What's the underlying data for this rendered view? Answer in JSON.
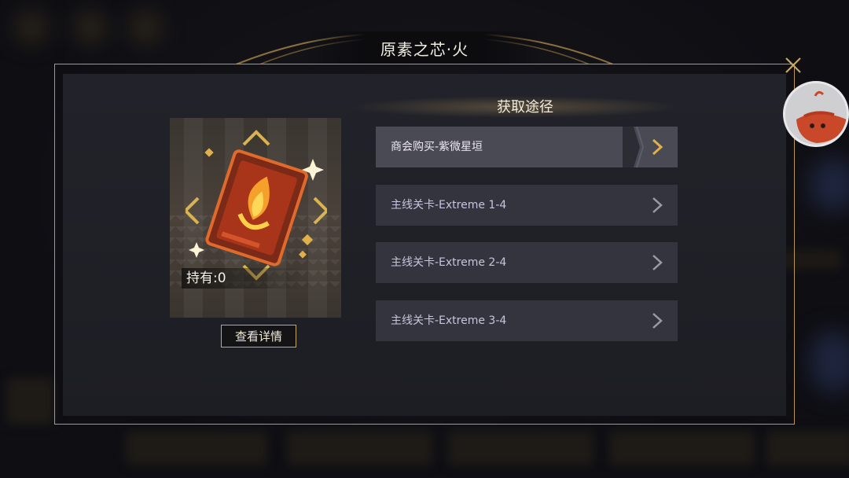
{
  "header": {
    "title": "原素之芯·火"
  },
  "item": {
    "owned_label": "持有:0",
    "detail_button": "查看详情",
    "art_icon": "fire-core-card-icon"
  },
  "sources": {
    "title": "获取途径",
    "items": [
      {
        "label": "商会购买-紫微星垣",
        "active": true
      },
      {
        "label": "主线关卡-Extreme 1-4",
        "active": false
      },
      {
        "label": "主线关卡-Extreme 2-4",
        "active": false
      },
      {
        "label": "主线关卡-Extreme 3-4",
        "active": false
      }
    ]
  },
  "colors": {
    "frame_gold": "#b9975b",
    "accent_gold": "#e0b04a",
    "panel_bg": "#22232a",
    "row_bg": "#33343d",
    "row_active_bg": "#4a4a55"
  }
}
